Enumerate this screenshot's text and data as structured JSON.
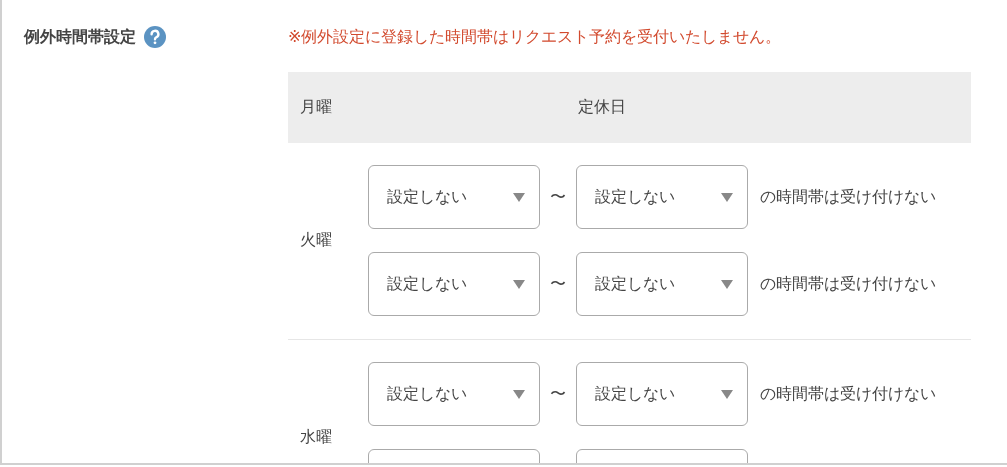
{
  "setting": {
    "label": "例外時間帯設定",
    "note": "※例外設定に登録した時間帯はリクエスト予約を受付いたしません。"
  },
  "header": {
    "day": "月曜",
    "status": "定休日"
  },
  "days": [
    {
      "day": "火曜",
      "ranges": [
        {
          "kind": "full",
          "from": "設定しない",
          "separator": "〜",
          "to": "設定しない",
          "suffix": "の時間帯は受け付けない"
        },
        {
          "kind": "full",
          "from": "設定しない",
          "separator": "〜",
          "to": "設定しない",
          "suffix": "の時間帯は受け付けない"
        }
      ]
    },
    {
      "day": "水曜",
      "ranges": [
        {
          "kind": "full",
          "from": "設定しない",
          "separator": "〜",
          "to": "設定しない",
          "suffix": "の時間帯は受け付けない"
        },
        {
          "kind": "clipped"
        }
      ]
    }
  ]
}
